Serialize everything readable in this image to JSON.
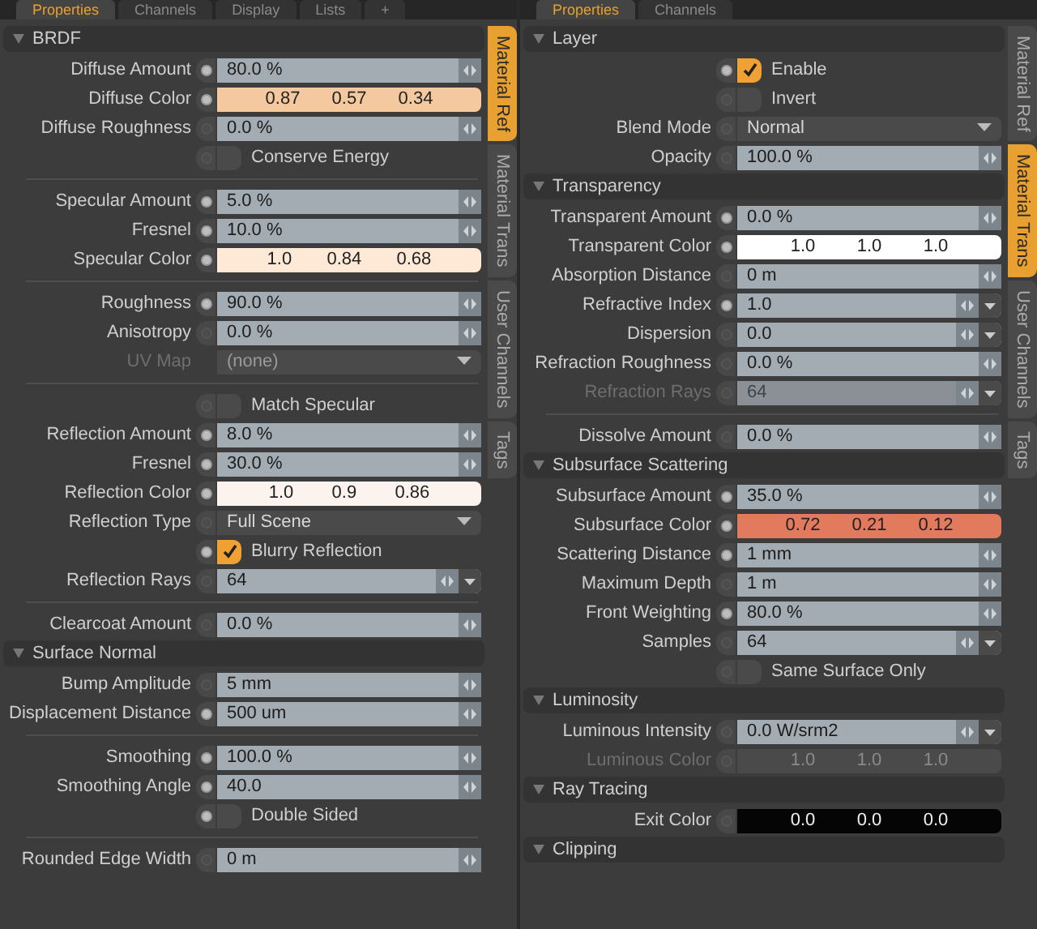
{
  "panels": [
    {
      "tabs": [
        {
          "label": "Properties",
          "selected": true
        },
        {
          "label": "Channels",
          "selected": false
        },
        {
          "label": "Display",
          "selected": false
        },
        {
          "label": "Lists",
          "selected": false
        },
        {
          "label": "+",
          "selected": false
        }
      ],
      "side_tabs": [
        {
          "label": "Material Ref",
          "selected": true
        },
        {
          "label": "Material Trans",
          "selected": false
        },
        {
          "label": "User Channels",
          "selected": false
        },
        {
          "label": "Tags",
          "selected": false
        }
      ],
      "sections": [
        {
          "title": "BRDF",
          "rows": [
            {
              "kind": "number",
              "label": "Diffuse Amount",
              "value": "80.0 %",
              "dot_on": true
            },
            {
              "kind": "color",
              "label": "Diffuse Color",
              "values": [
                "0.87",
                "0.57",
                "0.34"
              ],
              "color": "#f5c9a0",
              "dot_on": true
            },
            {
              "kind": "number",
              "label": "Diffuse Roughness",
              "value": "0.0 %",
              "dot_on": false
            },
            {
              "kind": "check",
              "label": "Conserve Energy",
              "checked": false,
              "dot_on": false
            },
            {
              "kind": "rule"
            },
            {
              "kind": "number",
              "label": "Specular Amount",
              "value": "5.0 %",
              "dot_on": true
            },
            {
              "kind": "number",
              "label": "Fresnel",
              "value": "10.0 %",
              "dot_on": true
            },
            {
              "kind": "color",
              "label": "Specular Color",
              "values": [
                "1.0",
                "0.84",
                "0.68"
              ],
              "color": "#fde9d6",
              "dot_on": true
            },
            {
              "kind": "rule"
            },
            {
              "kind": "number",
              "label": "Roughness",
              "value": "90.0 %",
              "dot_on": true
            },
            {
              "kind": "number",
              "label": "Anisotropy",
              "value": "0.0 %",
              "dot_on": false
            },
            {
              "kind": "select",
              "label": "UV Map",
              "value": "(none)",
              "disabled": true
            },
            {
              "kind": "rule"
            },
            {
              "kind": "check",
              "label": "Match Specular",
              "checked": false,
              "dot_on": false
            },
            {
              "kind": "number",
              "label": "Reflection Amount",
              "value": "8.0 %",
              "dot_on": true
            },
            {
              "kind": "number",
              "label": "Fresnel",
              "value": "30.0 %",
              "dot_on": true
            },
            {
              "kind": "color",
              "label": "Reflection Color",
              "values": [
                "1.0",
                "0.9",
                "0.86"
              ],
              "color": "#fdf3ee",
              "dot_on": true
            },
            {
              "kind": "select",
              "label": "Reflection Type",
              "value": "Full Scene",
              "dot_on": false
            },
            {
              "kind": "check",
              "label": "Blurry Reflection",
              "checked": true,
              "dot_on": true
            },
            {
              "kind": "number",
              "label": "Reflection Rays",
              "value": "64",
              "menu": true,
              "dot_on": false
            },
            {
              "kind": "rule"
            },
            {
              "kind": "number",
              "label": "Clearcoat Amount",
              "value": "0.0 %",
              "dot_on": false
            }
          ]
        },
        {
          "title": "Surface Normal",
          "rows": [
            {
              "kind": "number",
              "label": "Bump Amplitude",
              "value": "5 mm",
              "dot_on": false
            },
            {
              "kind": "number",
              "label": "Displacement Distance",
              "value": "500 um",
              "dot_on": true
            },
            {
              "kind": "rule"
            },
            {
              "kind": "number",
              "label": "Smoothing",
              "value": "100.0 %",
              "dot_on": true
            },
            {
              "kind": "number",
              "label": "Smoothing Angle",
              "value": "40.0",
              "dot_on": true
            },
            {
              "kind": "check",
              "label": "Double Sided",
              "checked": false,
              "dot_on": true
            },
            {
              "kind": "rule"
            },
            {
              "kind": "number",
              "label": "Rounded Edge Width",
              "value": "0 m",
              "dot_on": false
            }
          ]
        }
      ]
    },
    {
      "tabs": [
        {
          "label": "Properties",
          "selected": true
        },
        {
          "label": "Channels",
          "selected": false
        }
      ],
      "side_tabs": [
        {
          "label": "Material Ref",
          "selected": false
        },
        {
          "label": "Material Trans",
          "selected": true
        },
        {
          "label": "User Channels",
          "selected": false
        },
        {
          "label": "Tags",
          "selected": false
        }
      ],
      "sections": [
        {
          "title": "Layer",
          "rows": [
            {
              "kind": "check",
              "label": "Enable",
              "checked": true,
              "dot_on": true
            },
            {
              "kind": "check",
              "label": "Invert",
              "checked": false,
              "dot_on": false
            },
            {
              "kind": "select",
              "label": "Blend Mode",
              "value": "Normal",
              "dot_on": false
            },
            {
              "kind": "number",
              "label": "Opacity",
              "value": "100.0 %",
              "dot_on": false
            }
          ]
        },
        {
          "title": "Transparency",
          "rows": [
            {
              "kind": "number",
              "label": "Transparent Amount",
              "value": "0.0 %",
              "dot_on": true
            },
            {
              "kind": "color",
              "label": "Transparent Color",
              "values": [
                "1.0",
                "1.0",
                "1.0"
              ],
              "color": "#ffffff",
              "dot_on": true
            },
            {
              "kind": "number",
              "label": "Absorption Distance",
              "value": "0 m",
              "dot_on": false
            },
            {
              "kind": "number",
              "label": "Refractive Index",
              "value": "1.0",
              "menu": true,
              "dot_on": true
            },
            {
              "kind": "number",
              "label": "Dispersion",
              "value": "0.0",
              "menu": true,
              "dot_on": false
            },
            {
              "kind": "number",
              "label": "Refraction Roughness",
              "value": "0.0 %",
              "dot_on": false
            },
            {
              "kind": "number",
              "label": "Refraction Rays",
              "value": "64",
              "menu": true,
              "disabled": true,
              "dot_on": false
            },
            {
              "kind": "rule"
            },
            {
              "kind": "number",
              "label": "Dissolve Amount",
              "value": "0.0 %",
              "dot_on": false
            }
          ]
        },
        {
          "title": "Subsurface Scattering",
          "rows": [
            {
              "kind": "number",
              "label": "Subsurface Amount",
              "value": "35.0 %",
              "dot_on": true
            },
            {
              "kind": "color",
              "label": "Subsurface Color",
              "values": [
                "0.72",
                "0.21",
                "0.12"
              ],
              "color": "#e27a5e",
              "dot_on": true
            },
            {
              "kind": "number",
              "label": "Scattering Distance",
              "value": "1 mm",
              "dot_on": true
            },
            {
              "kind": "number",
              "label": "Maximum Depth",
              "value": "1 m",
              "dot_on": false
            },
            {
              "kind": "number",
              "label": "Front Weighting",
              "value": "80.0 %",
              "dot_on": true
            },
            {
              "kind": "number",
              "label": "Samples",
              "value": "64",
              "menu": true,
              "dot_on": false
            },
            {
              "kind": "check",
              "label": "Same Surface Only",
              "checked": false,
              "dot_on": false
            }
          ]
        },
        {
          "title": "Luminosity",
          "rows": [
            {
              "kind": "number",
              "label": "Luminous Intensity",
              "value": "0.0 W/srm2",
              "menu": true,
              "dot_on": false
            },
            {
              "kind": "color",
              "label": "Luminous Color",
              "values": [
                "1.0",
                "1.0",
                "1.0"
              ],
              "color": "#4a4a4a",
              "disabled": true,
              "dot_on": false
            }
          ]
        },
        {
          "title": "Ray Tracing",
          "rows": [
            {
              "kind": "color",
              "label": "Exit Color",
              "values": [
                "0.0",
                "0.0",
                "0.0"
              ],
              "color": "#050505",
              "dot_on": false
            }
          ]
        },
        {
          "title": "Clipping"
        }
      ]
    }
  ]
}
